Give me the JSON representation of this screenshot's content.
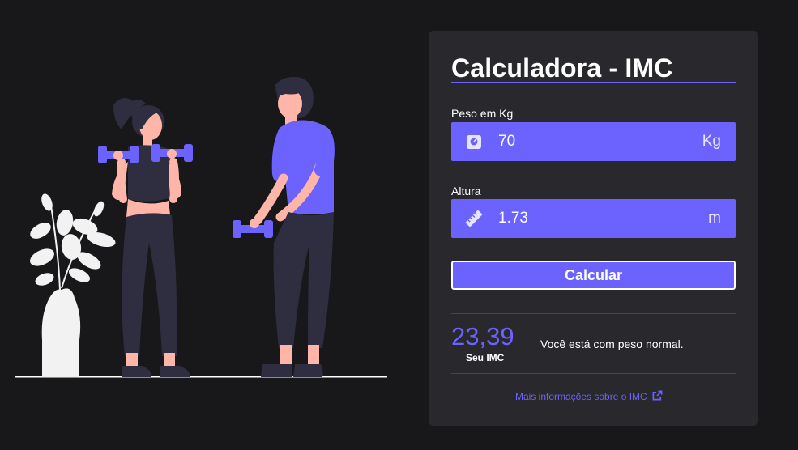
{
  "colors": {
    "accent": "#6c63ff",
    "background": "#18171a",
    "card": "#29282c"
  },
  "card": {
    "title": "Calculadora - IMC",
    "weight": {
      "label": "Peso em Kg",
      "value": "70",
      "unit": "Kg",
      "icon": "scale-icon"
    },
    "height": {
      "label": "Altura",
      "value": "1.73",
      "unit": "m",
      "icon": "ruler-icon"
    },
    "button": {
      "label": "Calcular"
    },
    "result": {
      "value": "23,39",
      "label": "Seu IMC",
      "message": "Você está com peso normal."
    },
    "link": {
      "label": "Mais informações sobre o IMC",
      "icon": "external-link-icon"
    }
  }
}
